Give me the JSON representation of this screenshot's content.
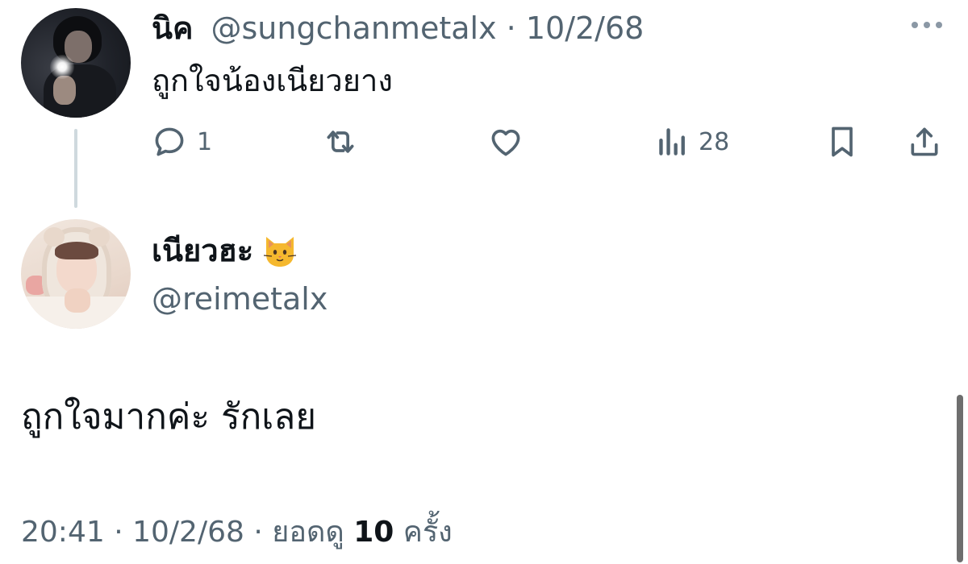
{
  "parent_tweet": {
    "display_name": "นิค",
    "handle": "@sungchanmetalx",
    "separator": "·",
    "date": "10/2/68",
    "text": "ถูกใจน้องเนียวยาง",
    "more_icon": "more-horizontal-icon",
    "actions": {
      "reply": {
        "icon": "reply-icon",
        "count": "1"
      },
      "retweet": {
        "icon": "retweet-icon",
        "count": ""
      },
      "like": {
        "icon": "heart-icon",
        "count": ""
      },
      "views": {
        "icon": "views-chart-icon",
        "count": "28"
      },
      "bookmark": {
        "icon": "bookmark-icon"
      },
      "share": {
        "icon": "share-icon"
      }
    }
  },
  "reply_tweet": {
    "display_name": "เนียวฮะ",
    "name_emoji": "cat-face-emoji",
    "handle": "@reimetalx",
    "text": "ถูกใจมากค่ะ รักเลย",
    "time": "20:41",
    "separator": "·",
    "date": "10/2/68",
    "views_prefix": "ยอดดู",
    "views_count": "10",
    "views_suffix": "ครั้ง"
  },
  "colors": {
    "text_primary": "#0f1419",
    "text_secondary": "#536471",
    "thread_line": "#cfd9de",
    "background": "#ffffff"
  }
}
